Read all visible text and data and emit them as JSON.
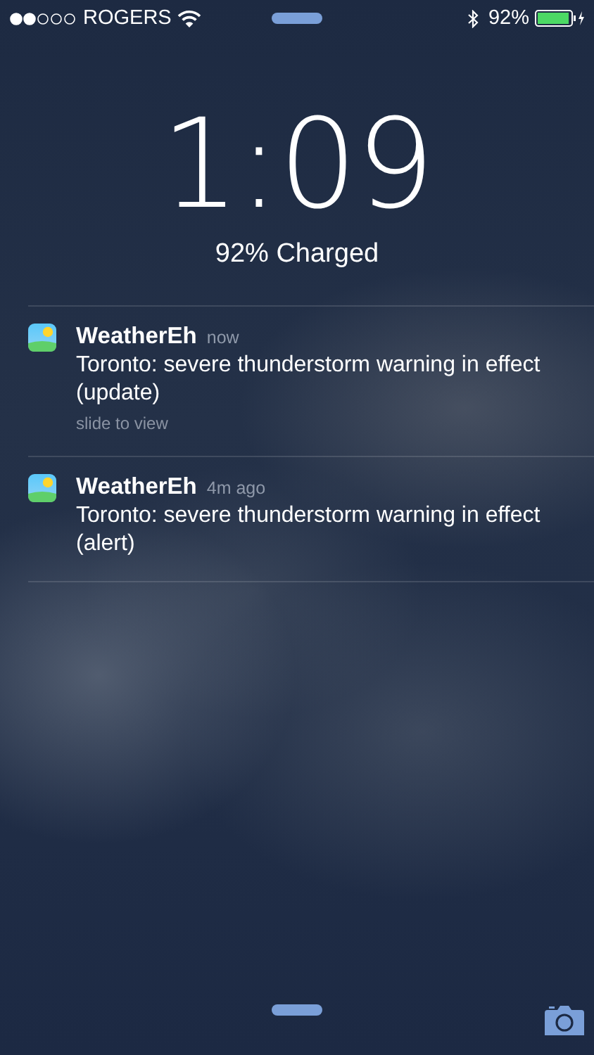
{
  "status_bar": {
    "carrier": "ROGERS",
    "battery": "92%"
  },
  "lock_screen": {
    "time": "1:09",
    "charge_status": "92% Charged"
  },
  "notifications": [
    {
      "app": "WeatherEh",
      "time": "now",
      "message": "Toronto: severe thunderstorm warning in effect (update)",
      "hint": "slide to view"
    },
    {
      "app": "WeatherEh",
      "time": "4m ago",
      "message": "Toronto: severe thunderstorm warning in effect (alert)"
    }
  ]
}
